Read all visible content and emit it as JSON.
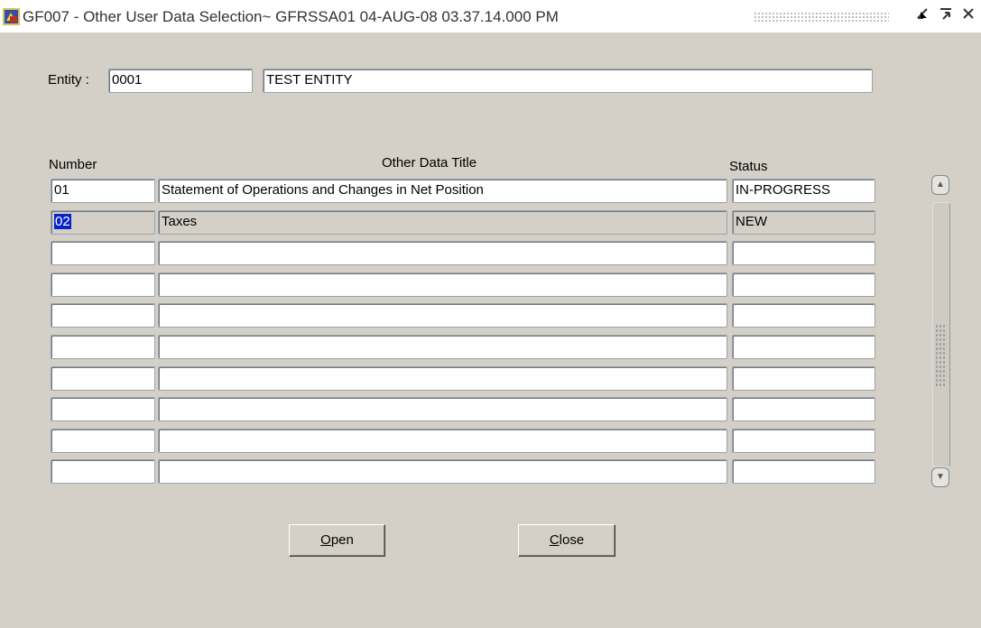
{
  "window": {
    "title": "GF007 - Other User Data Selection~ GFRSSA01  04-AUG-08 03.37.14.000 PM",
    "minimize_glyph": "⯈",
    "maximize_glyph": "⊼",
    "close_glyph": "✕"
  },
  "entity": {
    "label": "Entity :",
    "code": "0001",
    "name": "TEST ENTITY"
  },
  "table": {
    "headers": {
      "number": "Number",
      "title": "Other Data Title",
      "status": "Status"
    },
    "rows": [
      {
        "number": "01",
        "title": "Statement of Operations and Changes in Net Position",
        "status": "IN-PROGRESS"
      },
      {
        "number": "02",
        "title": "Taxes",
        "status": "NEW"
      },
      {
        "number": "",
        "title": "",
        "status": ""
      },
      {
        "number": "",
        "title": "",
        "status": ""
      },
      {
        "number": "",
        "title": "",
        "status": ""
      },
      {
        "number": "",
        "title": "",
        "status": ""
      },
      {
        "number": "",
        "title": "",
        "status": ""
      },
      {
        "number": "",
        "title": "",
        "status": ""
      },
      {
        "number": "",
        "title": "",
        "status": ""
      },
      {
        "number": "",
        "title": "",
        "status": ""
      }
    ],
    "selected_row": 1
  },
  "buttons": {
    "open": {
      "mnemonic": "O",
      "rest": "pen"
    },
    "close": {
      "mnemonic": "C",
      "rest": "lose"
    }
  },
  "scrollbar": {
    "up_glyph": "▲",
    "down_glyph": "▼"
  }
}
